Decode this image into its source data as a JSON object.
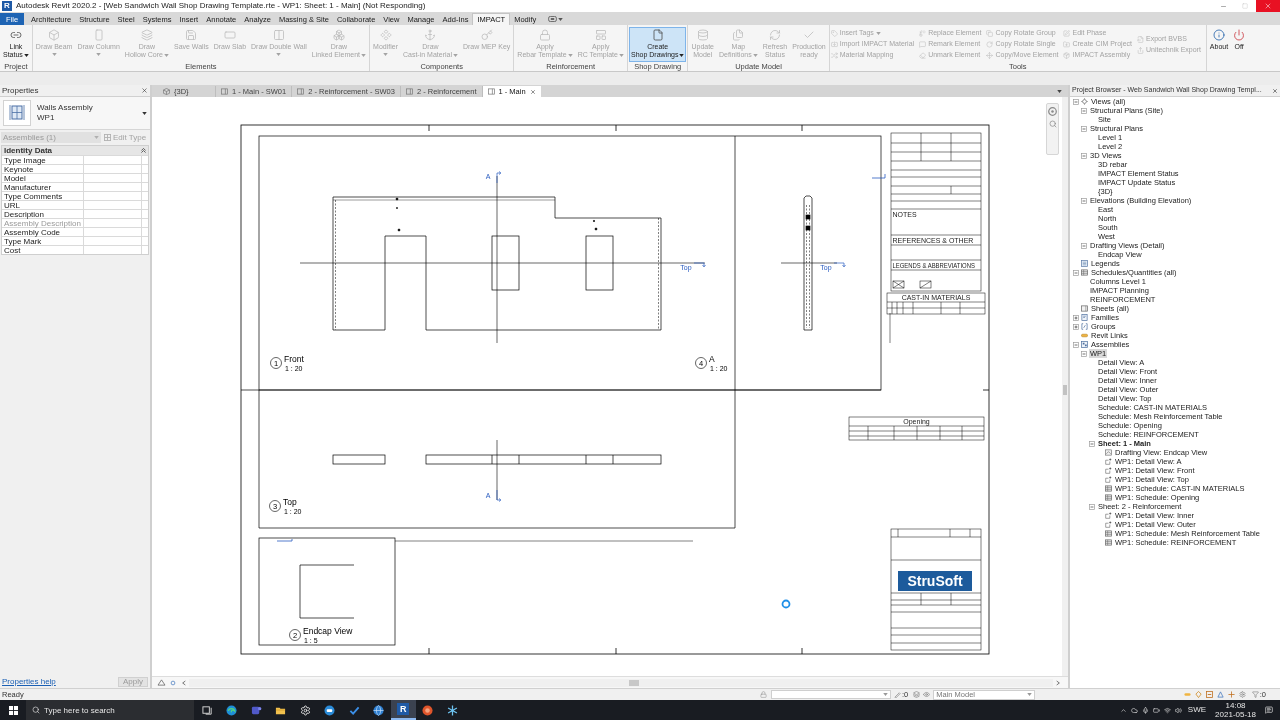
{
  "window": {
    "app_logo": "R",
    "title": "Autodesk Revit 2020.2 - [Web Sandwich Wall Shop Drawing Template.rte - WP1: Sheet: 1 - Main] (Not Responding)"
  },
  "menu_tabs": [
    {
      "label": "File",
      "kind": "file",
      "selected": false
    },
    {
      "label": "Architecture",
      "kind": "tab",
      "selected": false
    },
    {
      "label": "Structure",
      "kind": "tab",
      "selected": false
    },
    {
      "label": "Steel",
      "kind": "tab",
      "selected": false
    },
    {
      "label": "Systems",
      "kind": "tab",
      "selected": false
    },
    {
      "label": "Insert",
      "kind": "tab",
      "selected": false
    },
    {
      "label": "Annotate",
      "kind": "tab",
      "selected": false
    },
    {
      "label": "Analyze",
      "kind": "tab",
      "selected": false
    },
    {
      "label": "Massing & Site",
      "kind": "tab",
      "selected": false
    },
    {
      "label": "Collaborate",
      "kind": "tab",
      "selected": false
    },
    {
      "label": "View",
      "kind": "tab",
      "selected": false
    },
    {
      "label": "Manage",
      "kind": "tab",
      "selected": false
    },
    {
      "label": "Add-Ins",
      "kind": "tab",
      "selected": false
    },
    {
      "label": "IMPACT",
      "kind": "tab",
      "selected": true
    },
    {
      "label": "Modify",
      "kind": "tab",
      "selected": false
    }
  ],
  "ribbon": {
    "panels": [
      {
        "title": "Project",
        "tools": [
          {
            "kind": "large",
            "lines": [
              "Link",
              "Status"
            ],
            "caret": true,
            "disabled": false
          }
        ]
      },
      {
        "title": "Elements",
        "tools": [
          {
            "kind": "large",
            "lines": [
              "Draw Beam"
            ],
            "caret": true,
            "disabled": true
          },
          {
            "kind": "large",
            "lines": [
              "Draw Column"
            ],
            "caret": true,
            "disabled": true
          },
          {
            "kind": "large",
            "lines": [
              "Draw",
              "Hollow Core"
            ],
            "caret": true,
            "disabled": true
          },
          {
            "kind": "large",
            "lines": [
              "Save Walls"
            ],
            "caret": false,
            "disabled": true
          },
          {
            "kind": "large",
            "lines": [
              "Draw Slab"
            ],
            "caret": false,
            "disabled": true
          },
          {
            "kind": "large",
            "lines": [
              "Draw Double Wall"
            ],
            "caret": true,
            "disabled": true
          },
          {
            "kind": "large",
            "lines": [
              "Draw",
              "Linked Element"
            ],
            "caret": true,
            "disabled": true
          }
        ]
      },
      {
        "title": "Components",
        "tools": [
          {
            "kind": "large",
            "lines": [
              "Modifier"
            ],
            "caret": true,
            "disabled": true
          },
          {
            "kind": "large",
            "lines": [
              "Draw",
              "Cast-in Material"
            ],
            "caret": true,
            "disabled": true
          },
          {
            "kind": "large",
            "lines": [
              "Draw MEP Key"
            ],
            "caret": false,
            "disabled": true
          }
        ]
      },
      {
        "title": "Reinforcement",
        "tools": [
          {
            "kind": "large",
            "lines": [
              "Apply",
              "Rebar Template"
            ],
            "caret": true,
            "disabled": true
          },
          {
            "kind": "large",
            "lines": [
              "Apply",
              "RC Template"
            ],
            "caret": true,
            "disabled": true
          }
        ]
      },
      {
        "title": "Shop Drawing",
        "tools": [
          {
            "kind": "large",
            "lines": [
              "Create",
              "Shop Drawings"
            ],
            "caret": true,
            "disabled": false,
            "highlighted": true
          }
        ]
      },
      {
        "title": "Update Model",
        "tools": [
          {
            "kind": "large",
            "lines": [
              "Update",
              "Model"
            ],
            "caret": false,
            "disabled": true
          },
          {
            "kind": "large",
            "lines": [
              "Map",
              "Definitions"
            ],
            "caret": true,
            "disabled": true
          },
          {
            "kind": "large",
            "lines": [
              "Refresh",
              "Status"
            ],
            "caret": false,
            "disabled": true
          },
          {
            "kind": "large",
            "lines": [
              "Production",
              "ready"
            ],
            "caret": false,
            "disabled": true
          }
        ]
      },
      {
        "title": "Tools",
        "tools": [
          {
            "kind": "small",
            "label": "Insert Tags",
            "caret": true,
            "disabled": true
          },
          {
            "kind": "small",
            "label": "Import IMPACT Material",
            "caret": false,
            "disabled": true
          },
          {
            "kind": "small",
            "label": "Material Mapping",
            "caret": false,
            "disabled": true
          },
          {
            "kind": "small",
            "label": "Replace Element",
            "caret": false,
            "disabled": true
          },
          {
            "kind": "small",
            "label": "Remark Element",
            "caret": false,
            "disabled": true
          },
          {
            "kind": "small",
            "label": "Unmark Element",
            "caret": false,
            "disabled": true
          },
          {
            "kind": "small",
            "label": "Copy Rotate Group",
            "caret": false,
            "disabled": true
          },
          {
            "kind": "small",
            "label": "Copy Rotate Single",
            "caret": false,
            "disabled": true
          },
          {
            "kind": "small",
            "label": "Copy/Move Element",
            "caret": false,
            "disabled": true
          },
          {
            "kind": "small",
            "label": "Edit Phase",
            "caret": false,
            "disabled": true
          },
          {
            "kind": "small",
            "label": "Create CIM Project",
            "caret": false,
            "disabled": true
          },
          {
            "kind": "small",
            "label": "IMPACT Assembly",
            "caret": false,
            "disabled": true
          },
          {
            "kind": "small",
            "label": "Export BVBS",
            "caret": false,
            "disabled": true
          },
          {
            "kind": "small",
            "label": "Unitechnik Export",
            "caret": false,
            "disabled": true
          }
        ]
      },
      {
        "tools": [
          {
            "kind": "large",
            "lines": [
              "About"
            ],
            "caret": false,
            "disabled": false
          },
          {
            "kind": "large",
            "lines": [
              "Off"
            ],
            "caret": false,
            "disabled": false
          }
        ]
      }
    ]
  },
  "properties": {
    "title": "Properties",
    "type": {
      "name": "Walls Assembly",
      "subname": "WP1"
    },
    "filter": {
      "label": "Assemblies (1)",
      "disabled": true
    },
    "edit_type": {
      "label": "Edit Type",
      "disabled": true
    },
    "group": "Identity Data",
    "rows": [
      {
        "name": "Type Image",
        "disabled": false
      },
      {
        "name": "Keynote",
        "disabled": false
      },
      {
        "name": "Model",
        "disabled": false
      },
      {
        "name": "Manufacturer",
        "disabled": false
      },
      {
        "name": "Type Comments",
        "disabled": false
      },
      {
        "name": "URL",
        "disabled": false
      },
      {
        "name": "Description",
        "disabled": false
      },
      {
        "name": "Assembly Description",
        "disabled": true
      },
      {
        "name": "Assembly Code",
        "disabled": false
      },
      {
        "name": "Type Mark",
        "disabled": false
      },
      {
        "name": "Cost",
        "disabled": false
      }
    ],
    "help_link": "Properties help",
    "apply": {
      "label": "Apply",
      "disabled": true
    }
  },
  "view_tabs": [
    {
      "label": "{3D}",
      "kind": "model",
      "selected": false
    },
    {
      "label": "1 - Main - SW01",
      "kind": "sheet",
      "selected": false
    },
    {
      "label": "2 - Reinforcement - SW03",
      "kind": "sheet",
      "selected": false
    },
    {
      "label": "2 - Reinforcement",
      "kind": "sheet",
      "selected": false
    },
    {
      "label": "1 - Main",
      "kind": "sheet",
      "selected": true
    }
  ],
  "sheet": {
    "views": [
      {
        "number": "1",
        "title": "Front",
        "scale": "1 : 20"
      },
      {
        "number": "4",
        "title": "A",
        "scale": "1 : 20"
      },
      {
        "number": "3",
        "title": "Top",
        "scale": "1 : 20"
      },
      {
        "number": "2",
        "title": "Endcap View",
        "scale": "1 : 5"
      }
    ],
    "section_marks": [
      {
        "label": "A"
      },
      {
        "label": "Top"
      },
      {
        "label": "Top"
      },
      {
        "label": "A"
      }
    ],
    "title_block": {
      "headings": [
        "NOTES",
        "REFERENCES & OTHER",
        "LEGENDS & ABBREVIATIONS"
      ],
      "logo": "StruSoft"
    },
    "schedules": [
      {
        "title": "CAST-IN MATERIALS"
      },
      {
        "title": "Opening"
      }
    ]
  },
  "project_browser": {
    "title": "Project Browser - Web Sandwich Wall Shop Drawing Templ...",
    "tree": [
      {
        "label": "Views (all)",
        "kind": "views",
        "expanded": true,
        "selected": false,
        "children": [
          {
            "label": "Structural Plans (Site)",
            "expanded": true,
            "selected": false,
            "children": [
              {
                "label": "Site",
                "selected": false
              }
            ]
          },
          {
            "label": "Structural Plans",
            "expanded": true,
            "selected": false,
            "children": [
              {
                "label": "Level 1",
                "selected": false
              },
              {
                "label": "Level 2",
                "selected": false
              }
            ]
          },
          {
            "label": "3D Views",
            "expanded": true,
            "selected": false,
            "children": [
              {
                "label": "3D rebar",
                "selected": false
              },
              {
                "label": "IMPACT Element Status",
                "selected": false
              },
              {
                "label": "IMPACT Update Status",
                "selected": false
              },
              {
                "label": "{3D}",
                "selected": false
              }
            ]
          },
          {
            "label": "Elevations (Building Elevation)",
            "expanded": true,
            "selected": false,
            "children": [
              {
                "label": "East",
                "selected": false
              },
              {
                "label": "North",
                "selected": false
              },
              {
                "label": "South",
                "selected": false
              },
              {
                "label": "West",
                "selected": false
              }
            ]
          },
          {
            "label": "Drafting Views (Detail)",
            "expanded": true,
            "selected": false,
            "children": [
              {
                "label": "Endcap View",
                "selected": false
              }
            ]
          }
        ]
      },
      {
        "label": "Legends",
        "kind": "legends",
        "selected": false
      },
      {
        "label": "Schedules/Quantities (all)",
        "kind": "schedules",
        "expanded": true,
        "selected": false,
        "children": [
          {
            "label": "Columns Level 1",
            "selected": false
          },
          {
            "label": "IMPACT Planning",
            "selected": false
          },
          {
            "label": "REINFORCEMENT",
            "selected": false
          }
        ]
      },
      {
        "label": "Sheets (all)",
        "kind": "sheets",
        "selected": false
      },
      {
        "label": "Families",
        "kind": "families",
        "expanded": false,
        "selected": false
      },
      {
        "label": "Groups",
        "kind": "groups",
        "expanded": false,
        "selected": false
      },
      {
        "label": "Revit Links",
        "kind": "links",
        "selected": false
      },
      {
        "label": "Assemblies",
        "kind": "assemblies",
        "expanded": true,
        "selected": false,
        "children": [
          {
            "label": "WP1",
            "expanded": true,
            "selected": true,
            "children": [
              {
                "label": "Detail View: A",
                "selected": false,
                "active": false
              },
              {
                "label": "Detail View: Front",
                "selected": false,
                "active": false
              },
              {
                "label": "Detail View: Inner",
                "selected": false,
                "active": false
              },
              {
                "label": "Detail View: Outer",
                "selected": false,
                "active": false
              },
              {
                "label": "Detail View: Top",
                "selected": false,
                "active": false
              },
              {
                "label": "Schedule: CAST-IN MATERIALS",
                "selected": false,
                "active": false
              },
              {
                "label": "Schedule: Mesh Reinforcement Table",
                "selected": false,
                "active": false
              },
              {
                "label": "Schedule: Opening",
                "selected": false,
                "active": false
              },
              {
                "label": "Schedule: REINFORCEMENT",
                "selected": false,
                "active": false
              },
              {
                "label": "Sheet: 1 - Main",
                "expanded": true,
                "selected": false,
                "active": true,
                "children": [
                  {
                    "label": "Drafting View: Endcap View",
                    "kind": "drafting",
                    "selected": false
                  },
                  {
                    "label": "WP1: Detail View: A",
                    "kind": "detail",
                    "selected": false
                  },
                  {
                    "label": "WP1: Detail View: Front",
                    "kind": "detail",
                    "selected": false
                  },
                  {
                    "label": "WP1: Detail View: Top",
                    "kind": "detail",
                    "selected": false
                  },
                  {
                    "label": "WP1: Schedule: CAST-IN MATERIALS",
                    "kind": "schedule",
                    "selected": false
                  },
                  {
                    "label": "WP1: Schedule: Opening",
                    "kind": "schedule",
                    "selected": false
                  }
                ]
              },
              {
                "label": "Sheet: 2 - Reinforcement",
                "expanded": true,
                "selected": false,
                "active": false,
                "children": [
                  {
                    "label": "WP1: Detail View: Inner",
                    "kind": "detail",
                    "selected": false
                  },
                  {
                    "label": "WP1: Detail View: Outer",
                    "kind": "detail",
                    "selected": false
                  },
                  {
                    "label": "WP1: Schedule: Mesh Reinforcement Table",
                    "kind": "schedule",
                    "selected": false
                  },
                  {
                    "label": "WP1: Schedule: REINFORCEMENT",
                    "kind": "schedule",
                    "selected": false
                  }
                ]
              }
            ]
          }
        ]
      }
    ]
  },
  "status_bar": {
    "message": "Ready",
    "editable_count": ":0",
    "model": "Main Model",
    "filter_count": ":0"
  },
  "taskbar": {
    "search_placeholder": "Type here to search",
    "apps": [
      {
        "active": false
      },
      {
        "active": false
      },
      {
        "active": false
      },
      {
        "active": false
      },
      {
        "active": false
      },
      {
        "active": false
      },
      {
        "active": false
      },
      {
        "active": false
      },
      {
        "active": true,
        "letter": "R"
      },
      {
        "active": false
      },
      {
        "active": false
      }
    ],
    "language": "SWE",
    "time": "14:08",
    "date": "2021-05-18"
  }
}
